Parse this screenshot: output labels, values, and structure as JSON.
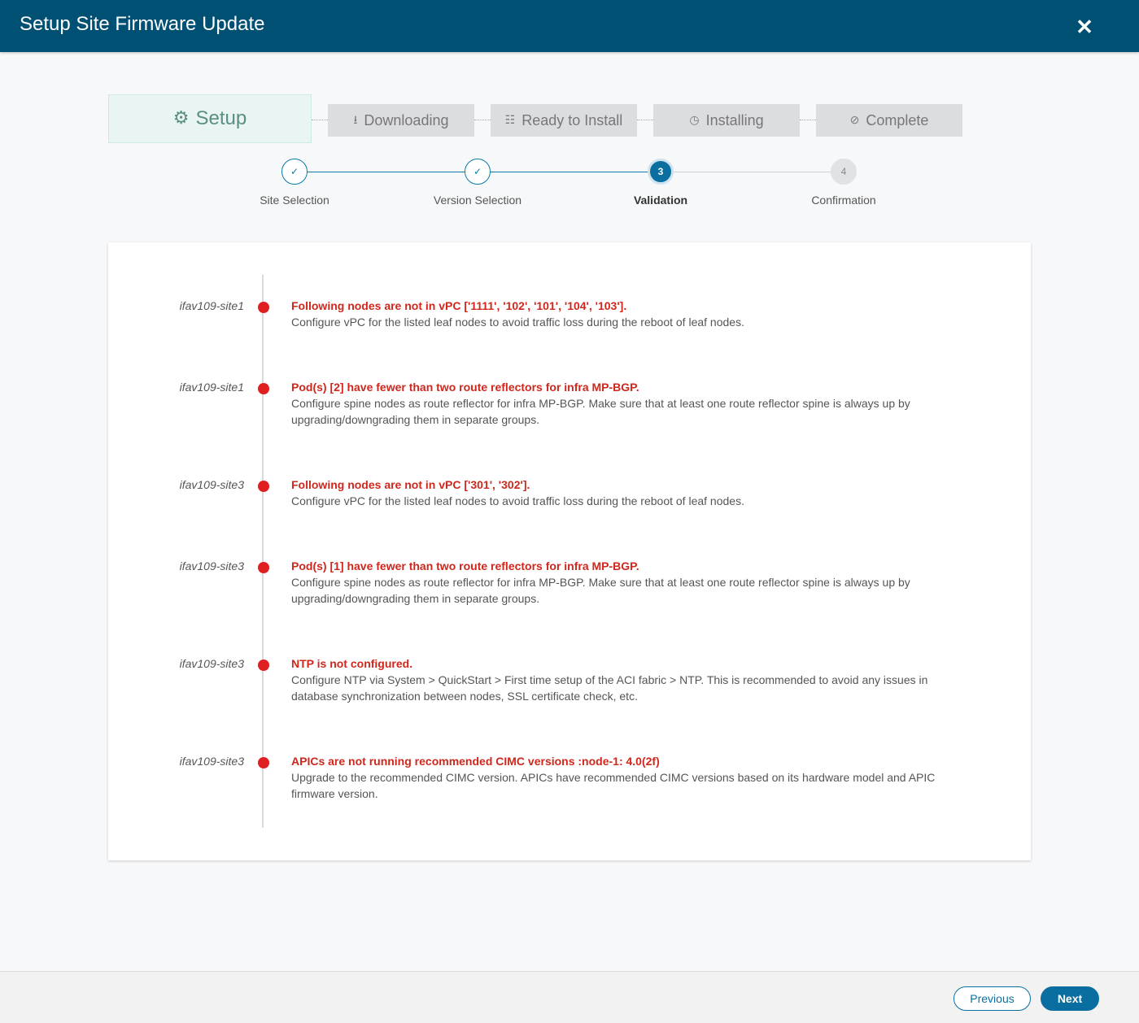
{
  "window": {
    "title": "Setup Site Firmware Update",
    "close_glyph": "✕"
  },
  "stages": [
    {
      "label": "Setup",
      "icon": "gear-icon",
      "glyph": "⚙",
      "active": true
    },
    {
      "label": "Downloading",
      "icon": "download-icon",
      "glyph": "⭳",
      "active": false
    },
    {
      "label": "Ready to Install",
      "icon": "checklist-icon",
      "glyph": "☷",
      "active": false
    },
    {
      "label": "Installing",
      "icon": "clock-icon",
      "glyph": "◷",
      "active": false
    },
    {
      "label": "Complete",
      "icon": "check-circle-icon",
      "glyph": "⊘",
      "active": false
    }
  ],
  "steps": [
    {
      "label": "Site Selection",
      "marker": "✓",
      "state": "done"
    },
    {
      "label": "Version Selection",
      "marker": "✓",
      "state": "done"
    },
    {
      "label": "Validation",
      "marker": "3",
      "state": "current"
    },
    {
      "label": "Confirmation",
      "marker": "4",
      "state": "future"
    }
  ],
  "validations": [
    {
      "site": "ifav109-site1",
      "title": "Following nodes are not in vPC ['1111', '102', '101', '104', '103'].",
      "description": "Configure vPC for the listed leaf nodes to avoid traffic loss during the reboot of leaf nodes."
    },
    {
      "site": "ifav109-site1",
      "title": "Pod(s) [2] have fewer than two route reflectors for infra MP-BGP.",
      "description": "Configure spine nodes as route reflector for infra MP-BGP. Make sure that at least one route reflector spine is always up by upgrading/downgrading them in separate groups."
    },
    {
      "site": "ifav109-site3",
      "title": "Following nodes are not in vPC ['301', '302'].",
      "description": "Configure vPC for the listed leaf nodes to avoid traffic loss during the reboot of leaf nodes."
    },
    {
      "site": "ifav109-site3",
      "title": "Pod(s) [1] have fewer than two route reflectors for infra MP-BGP.",
      "description": "Configure spine nodes as route reflector for infra MP-BGP. Make sure that at least one route reflector spine is always up by upgrading/downgrading them in separate groups."
    },
    {
      "site": "ifav109-site3",
      "title": "NTP is not configured.",
      "description": "Configure NTP via System > QuickStart > First time setup of the ACI fabric > NTP. This is recommended to avoid any issues in database synchronization between nodes, SSL certificate check, etc."
    },
    {
      "site": "ifav109-site3",
      "title": "APICs are not running recommended CIMC versions :node-1: 4.0(2f)",
      "description": "Upgrade to the recommended CIMC version. APICs have recommended CIMC versions based on its hardware model and APIC firmware version."
    }
  ],
  "footer": {
    "previous_label": "Previous",
    "next_label": "Next"
  },
  "colors": {
    "header": "#005073",
    "primary": "#0a6fa0",
    "error": "#e02020",
    "error_text": "#d0271d"
  }
}
